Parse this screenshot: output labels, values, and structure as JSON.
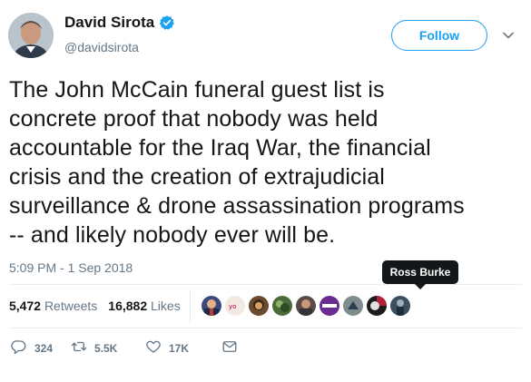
{
  "author": {
    "display_name": "David Sirota",
    "handle": "@davidsirota",
    "verified": true
  },
  "follow_button": {
    "label": "Follow"
  },
  "tweet": {
    "text": "The John McCain funeral guest list is\nconcrete proof that nobody was held\naccountable for the Iraq War, the financial\ncrisis and the creation of extrajudicial\nsurveillance & drone assassination programs\n-- and likely nobody ever will be.",
    "timestamp": "5:09 PM - 1 Sep 2018"
  },
  "stats": {
    "retweets_count": "5,472",
    "retweets_label": "Retweets",
    "likes_count": "16,882",
    "likes_label": "Likes"
  },
  "tooltip": {
    "text": "Ross Burke"
  },
  "actions": {
    "reply_count": "324",
    "retweet_count": "5.5K",
    "like_count": "17K"
  },
  "colors": {
    "accent": "#1da1f2",
    "text": "#14171a",
    "muted": "#657786",
    "divider": "#e6ecf0"
  },
  "icons": [
    "verified-badge-icon",
    "chevron-down-icon",
    "reply-icon",
    "retweet-icon",
    "heart-icon",
    "message-icon"
  ]
}
